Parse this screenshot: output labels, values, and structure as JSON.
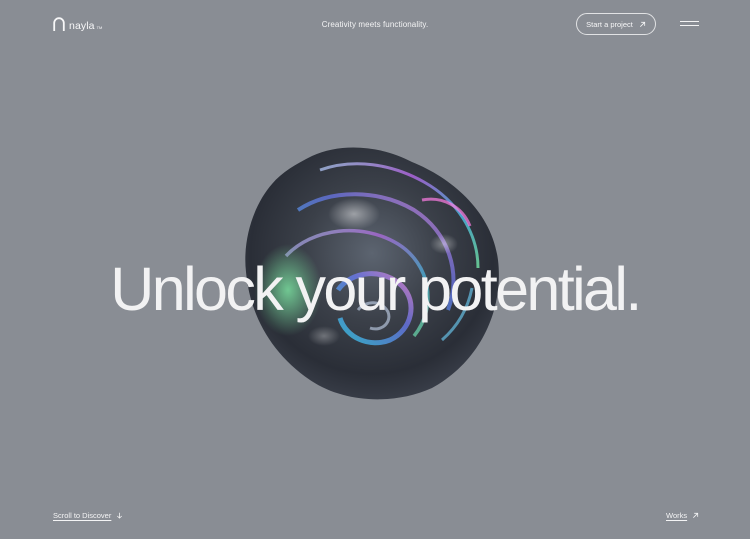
{
  "header": {
    "logo_text": "nayla",
    "logo_tm": "TM",
    "tagline": "Creativity meets functionality.",
    "cta_label": "Start a project",
    "cta_icon": "arrow-up-right-icon",
    "menu_icon": "hamburger-menu-icon"
  },
  "hero": {
    "headline": "Unlock your potential.",
    "visual": "iridescent-3d-blob"
  },
  "footer": {
    "scroll_label": "Scroll to Discover",
    "scroll_icon": "arrow-down-icon",
    "works_label": "Works",
    "works_icon": "arrow-up-right-icon"
  },
  "colors": {
    "background": "#898d94",
    "text": "#f2f2f3"
  }
}
